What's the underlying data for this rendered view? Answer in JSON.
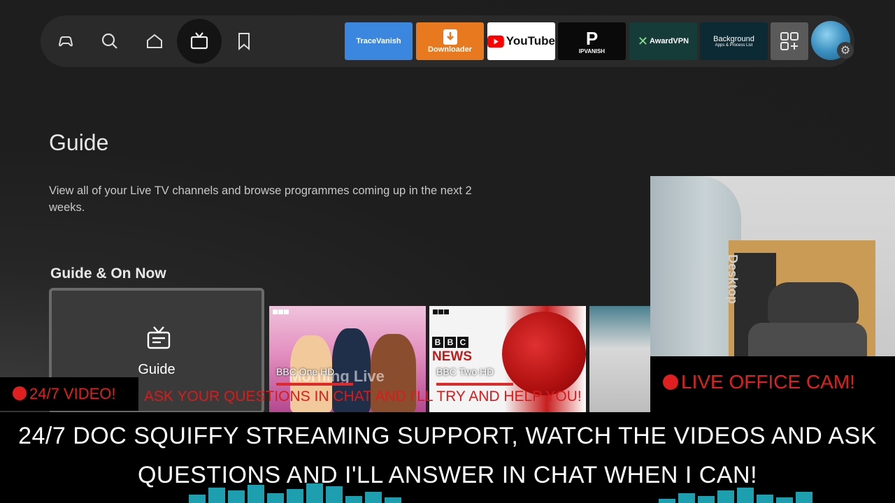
{
  "nav": {
    "icons": [
      "gamepad-icon",
      "search-icon",
      "home-icon",
      "live-tv-icon",
      "bookmark-icon"
    ],
    "active": "live-tv-icon",
    "apps": [
      {
        "label": "TraceVanish",
        "color": "#3b87e0"
      },
      {
        "label": "Downloader",
        "color": "#e9791f"
      },
      {
        "label": "YouTube",
        "color": "#ffffff"
      },
      {
        "label": "IPVANISH",
        "color": "#0a0a0a"
      },
      {
        "label": "AwardVPN",
        "color": "#163c3a"
      },
      {
        "label": "Background",
        "sublabel": "Apps & Process List",
        "color": "#0c2a33"
      }
    ]
  },
  "page": {
    "title": "Guide",
    "description": "View all of your Live TV channels and browse programmes coming up in the next 2 weeks."
  },
  "row": {
    "title": "Guide & On Now",
    "guide_card_label": "Guide",
    "channels": [
      {
        "name": "BBC One HD",
        "show": "Morning Live"
      },
      {
        "name": "BBC Two HD",
        "logo": "NEWS"
      }
    ]
  },
  "overlay": {
    "cam_label": "LIVE OFFICE CAM!",
    "cam_text": "Desktop",
    "badge": "24/7 VIDEO!",
    "ticker": "ASK YOUR QUESTIONS IN CHAT AND I'LL TRY AND HELP YOU!",
    "banner": "24/7 DOC SQUIFFY STREAMING SUPPORT, WATCH THE VIDEOS AND ASK QUESTIONS AND I'LL ANSWER IN CHAT WHEN I CAN!"
  },
  "colors": {
    "accent_red": "#e02020",
    "nav_bg": "#2a2a2a",
    "background": "#1d1d1d"
  }
}
